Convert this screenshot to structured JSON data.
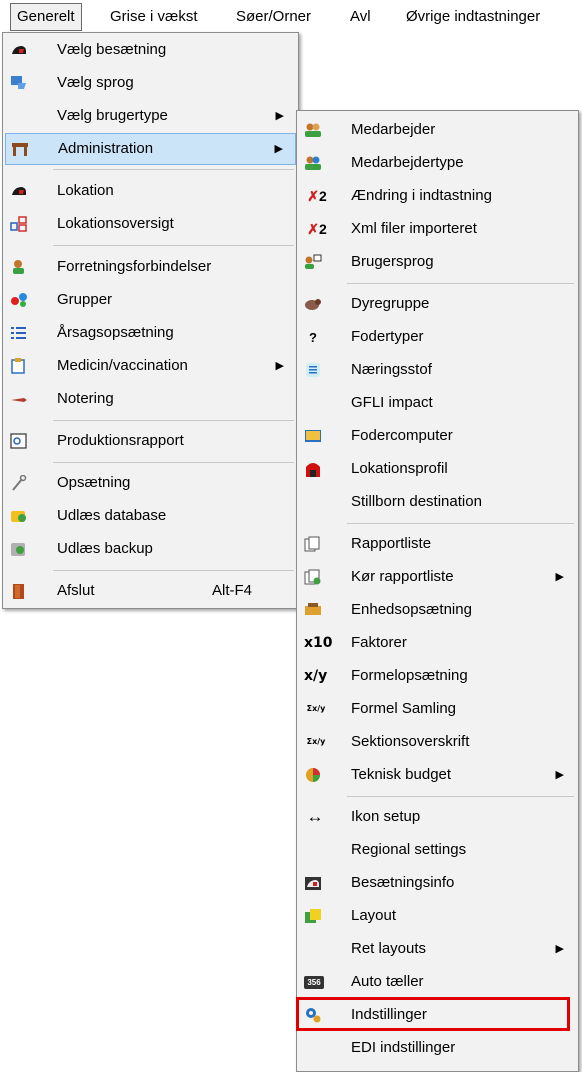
{
  "menubar": {
    "items": [
      "Generelt",
      "Grise i vækst",
      "Søer/Orner",
      "Avl",
      "Øvrige indtastninger"
    ]
  },
  "main_menu": {
    "items": [
      {
        "label": "Vælg besætning",
        "icon": "herd-icon"
      },
      {
        "label": "Vælg sprog",
        "icon": "language-icon"
      },
      {
        "label": "Vælg brugertype",
        "icon": "",
        "submenu": true
      },
      {
        "label": "Administration",
        "icon": "administration-icon",
        "submenu": true,
        "selected": true
      },
      {
        "label": "Lokation",
        "icon": "location-icon"
      },
      {
        "label": "Lokationsoversigt",
        "icon": "location-overview-icon"
      },
      {
        "label": "Forretningsforbindelser",
        "icon": "business-contacts-icon"
      },
      {
        "label": "Grupper",
        "icon": "groups-icon"
      },
      {
        "label": "Årsagsopsætning",
        "icon": "cause-setup-icon"
      },
      {
        "label": "Medicin/vaccination",
        "icon": "medicine-icon",
        "submenu": true
      },
      {
        "label": "Notering",
        "icon": "notation-icon"
      },
      {
        "label": "Produktionsrapport",
        "icon": "production-report-icon"
      },
      {
        "label": "Opsætning",
        "icon": "wrench-icon"
      },
      {
        "label": "Udlæs database",
        "icon": "export-database-icon"
      },
      {
        "label": "Udlæs backup",
        "icon": "export-backup-icon"
      },
      {
        "label": "Afslut",
        "icon": "exit-door-icon",
        "shortcut": "Alt-F4"
      }
    ]
  },
  "sub_menu": {
    "items": [
      {
        "label": "Medarbejder",
        "icon": "employee-icon"
      },
      {
        "label": "Medarbejdertype",
        "icon": "employee-type-icon"
      },
      {
        "label": "Ændring i indtastning",
        "icon": "x2-icon"
      },
      {
        "label": "Xml filer importeret",
        "icon": "x2-icon"
      },
      {
        "label": "Brugersprog",
        "icon": "user-language-icon"
      },
      {
        "label": "Dyregruppe",
        "icon": "animal-group-icon"
      },
      {
        "label": "Fodertyper",
        "icon": "feed-types-icon"
      },
      {
        "label": "Næringsstof",
        "icon": "nutrient-icon"
      },
      {
        "label": "GFLI impact",
        "icon": ""
      },
      {
        "label": "Fodercomputer",
        "icon": "feed-computer-icon"
      },
      {
        "label": "Lokationsprofil",
        "icon": "location-profile-icon"
      },
      {
        "label": "Stillborn destination",
        "icon": ""
      },
      {
        "label": "Rapportliste",
        "icon": "report-list-icon"
      },
      {
        "label": "Kør rapportliste",
        "icon": "run-report-list-icon",
        "submenu": true
      },
      {
        "label": "Enhedsopsætning",
        "icon": "unit-setup-icon"
      },
      {
        "label": "Faktorer",
        "icon": "factors-icon",
        "glyph": "x10"
      },
      {
        "label": "Formelopsætning",
        "icon": "formula-icon",
        "glyph": "x/y"
      },
      {
        "label": "Formel Samling",
        "icon": "formula-collection-icon",
        "glyph": "Σx/y"
      },
      {
        "label": "Sektionsoverskrift",
        "icon": "section-header-icon",
        "glyph": "Σx/y"
      },
      {
        "label": "Teknisk budget",
        "icon": "budget-pie-icon",
        "submenu": true
      },
      {
        "label": "Ikon setup",
        "icon": "arrows-horizontal-icon"
      },
      {
        "label": "Regional settings",
        "icon": ""
      },
      {
        "label": "Besætningsinfo",
        "icon": "herd-info-icon"
      },
      {
        "label": "Layout",
        "icon": "layout-icon"
      },
      {
        "label": "Ret layouts",
        "icon": "",
        "submenu": true
      },
      {
        "label": "Auto tæller",
        "icon": "auto-counter-icon"
      },
      {
        "label": "Indstillinger",
        "icon": "settings-gear-icon",
        "highlighted": true
      },
      {
        "label": "EDI indstillinger",
        "icon": ""
      }
    ]
  },
  "glyphs": {
    "arrow": "▶",
    "x2": "2",
    "x10": "x10",
    "xy": "x/y",
    "sxy": "Σx/y",
    "lr": "↔",
    "counter": "356"
  },
  "colors": {
    "menu_bg": "#f2f2f2",
    "selected_bg": "#cce4f7",
    "selected_border": "#7eb4ea",
    "highlight_box": "#e00000"
  }
}
